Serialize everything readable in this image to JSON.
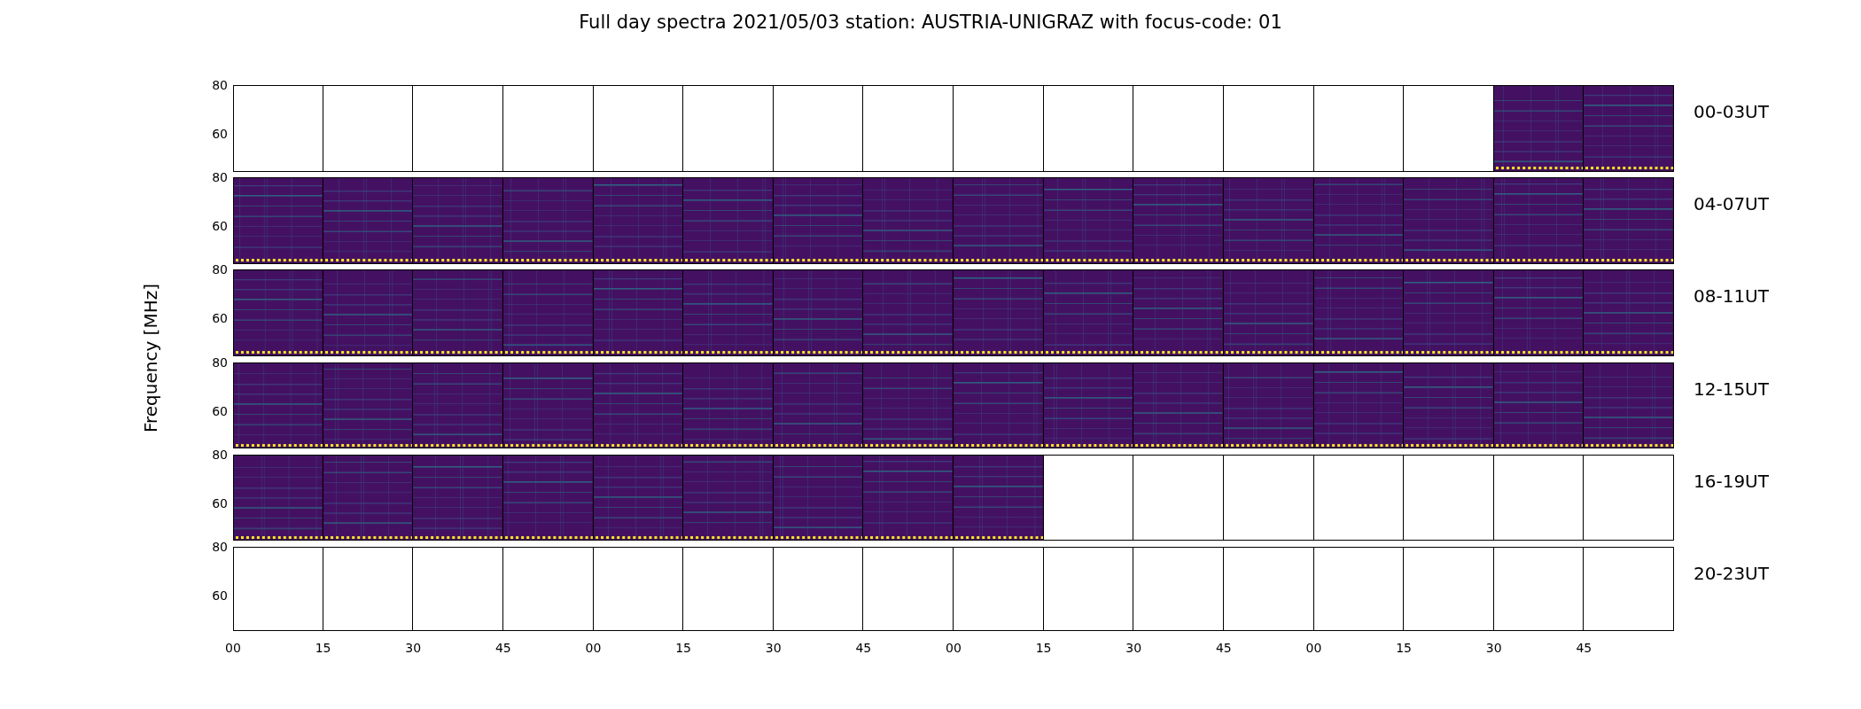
{
  "title": "Full day spectra 2021/05/03 station: AUSTRIA-UNIGRAZ with focus-code: 01",
  "y_axis": {
    "label": "Frequency [MHz]"
  },
  "rows": [
    {
      "label": "00-03UT",
      "yticks": [
        "80",
        "60"
      ],
      "panels": [
        {
          "filled": false
        },
        {
          "filled": false
        },
        {
          "filled": false
        },
        {
          "filled": false
        },
        {
          "filled": false
        },
        {
          "filled": false
        },
        {
          "filled": false
        },
        {
          "filled": false
        },
        {
          "filled": false
        },
        {
          "filled": false
        },
        {
          "filled": false
        },
        {
          "filled": false
        },
        {
          "filled": false
        },
        {
          "filled": false
        },
        {
          "filled": true
        },
        {
          "filled": true
        }
      ]
    },
    {
      "label": "04-07UT",
      "yticks": [
        "80",
        "60"
      ],
      "panels": [
        {
          "filled": true
        },
        {
          "filled": true
        },
        {
          "filled": true
        },
        {
          "filled": true
        },
        {
          "filled": true
        },
        {
          "filled": true
        },
        {
          "filled": true
        },
        {
          "filled": true
        },
        {
          "filled": true
        },
        {
          "filled": true
        },
        {
          "filled": true
        },
        {
          "filled": true
        },
        {
          "filled": true
        },
        {
          "filled": true
        },
        {
          "filled": true
        },
        {
          "filled": true
        }
      ]
    },
    {
      "label": "08-11UT",
      "yticks": [
        "80",
        "60"
      ],
      "panels": [
        {
          "filled": true
        },
        {
          "filled": true
        },
        {
          "filled": true
        },
        {
          "filled": true
        },
        {
          "filled": true
        },
        {
          "filled": true
        },
        {
          "filled": true
        },
        {
          "filled": true
        },
        {
          "filled": true
        },
        {
          "filled": true
        },
        {
          "filled": true
        },
        {
          "filled": true
        },
        {
          "filled": true
        },
        {
          "filled": true
        },
        {
          "filled": true
        },
        {
          "filled": true
        }
      ]
    },
    {
      "label": "12-15UT",
      "yticks": [
        "80",
        "60"
      ],
      "panels": [
        {
          "filled": true
        },
        {
          "filled": true
        },
        {
          "filled": true
        },
        {
          "filled": true
        },
        {
          "filled": true
        },
        {
          "filled": true
        },
        {
          "filled": true
        },
        {
          "filled": true
        },
        {
          "filled": true
        },
        {
          "filled": true
        },
        {
          "filled": true
        },
        {
          "filled": true
        },
        {
          "filled": true
        },
        {
          "filled": true
        },
        {
          "filled": true
        },
        {
          "filled": true
        }
      ]
    },
    {
      "label": "16-19UT",
      "yticks": [
        "80",
        "60"
      ],
      "panels": [
        {
          "filled": true
        },
        {
          "filled": true
        },
        {
          "filled": true
        },
        {
          "filled": true
        },
        {
          "filled": true
        },
        {
          "filled": true
        },
        {
          "filled": true
        },
        {
          "filled": true
        },
        {
          "filled": true
        },
        {
          "filled": false
        },
        {
          "filled": false
        },
        {
          "filled": false
        },
        {
          "filled": false
        },
        {
          "filled": false
        },
        {
          "filled": false
        },
        {
          "filled": false
        }
      ]
    },
    {
      "label": "20-23UT",
      "yticks": [
        "80",
        "60"
      ],
      "panels": [
        {
          "filled": false
        },
        {
          "filled": false
        },
        {
          "filled": false
        },
        {
          "filled": false
        },
        {
          "filled": false
        },
        {
          "filled": false
        },
        {
          "filled": false
        },
        {
          "filled": false
        },
        {
          "filled": false
        },
        {
          "filled": false
        },
        {
          "filled": false
        },
        {
          "filled": false
        },
        {
          "filled": false
        },
        {
          "filled": false
        },
        {
          "filled": false
        },
        {
          "filled": false
        }
      ]
    }
  ],
  "x_axis": {
    "ticks": [
      "00",
      "15",
      "30",
      "45",
      "00",
      "15",
      "30",
      "45",
      "00",
      "15",
      "30",
      "45",
      "00",
      "15",
      "30",
      "45"
    ]
  }
}
